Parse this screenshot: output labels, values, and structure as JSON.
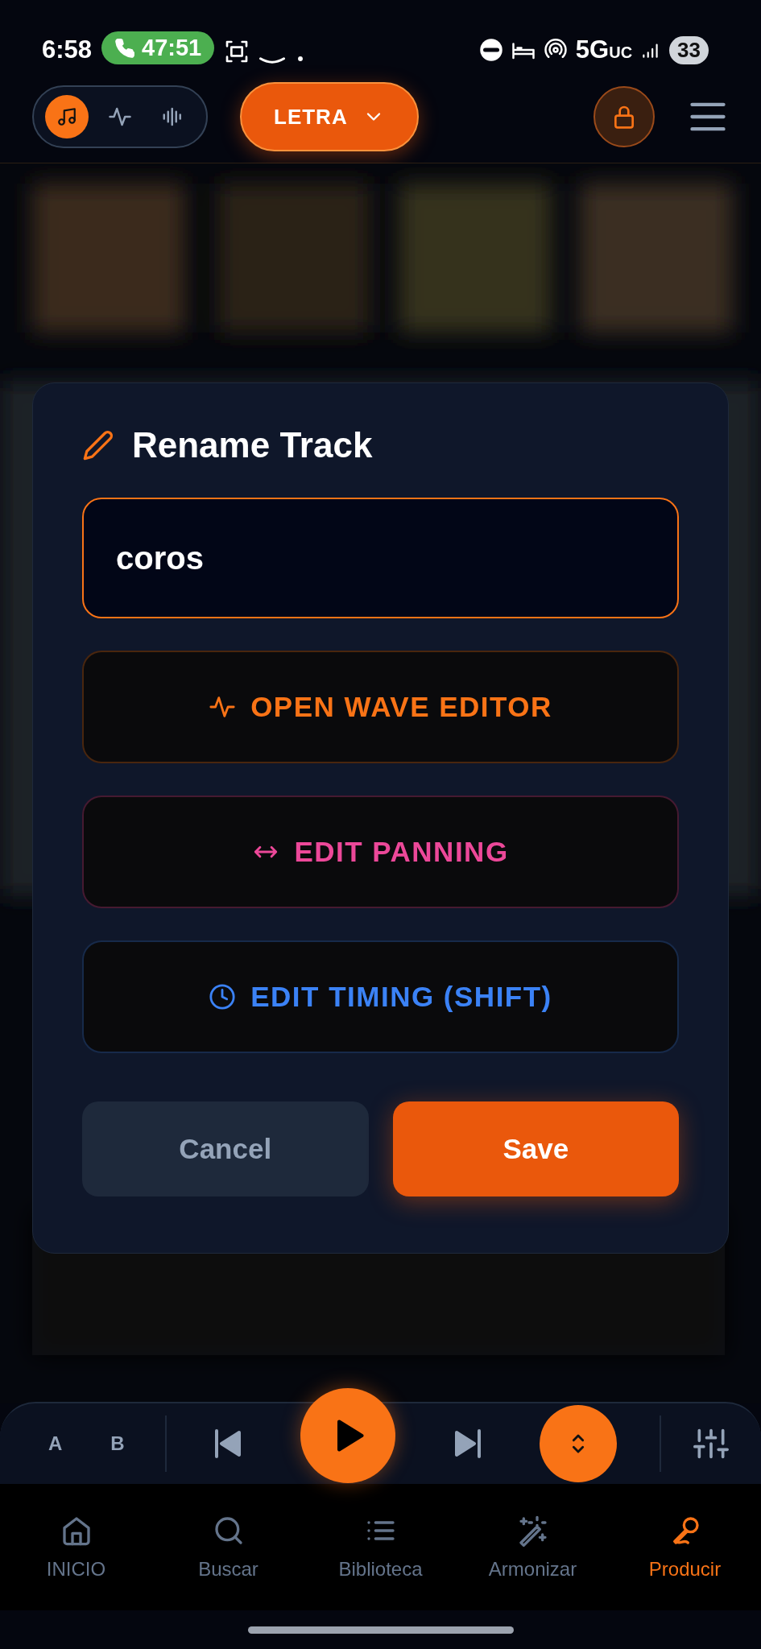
{
  "status_bar": {
    "time": "6:58",
    "call_duration": "47:51",
    "network": "5G",
    "network_suffix": "UC",
    "battery": "33"
  },
  "top_bar": {
    "mode_tabs": [
      {
        "kind": "music",
        "selected": true
      },
      {
        "kind": "pulse",
        "selected": false
      },
      {
        "kind": "wave",
        "selected": false
      }
    ],
    "view_button": "LETRA"
  },
  "dialog": {
    "title": "Rename Track",
    "input": {
      "value": "coros"
    },
    "actions": [
      {
        "kind": "wave",
        "label": "OPEN WAVE EDITOR",
        "color": "#f97316"
      },
      {
        "kind": "panning",
        "label": "EDIT PANNING",
        "color": "#ec4899"
      },
      {
        "kind": "timing",
        "label": "EDIT TIMING (SHIFT)",
        "color": "#3b82f6"
      }
    ],
    "cancel": "Cancel",
    "save": "Save"
  },
  "player": {
    "ab": [
      "A",
      "B"
    ]
  },
  "nav": [
    {
      "kind": "home",
      "label": "INICIO",
      "selected": false
    },
    {
      "kind": "search",
      "label": "Buscar",
      "selected": false
    },
    {
      "kind": "list",
      "label": "Biblioteca",
      "selected": false
    },
    {
      "kind": "wand",
      "label": "Armonizar",
      "selected": false
    },
    {
      "kind": "mic",
      "label": "Producir",
      "selected": true
    }
  ]
}
